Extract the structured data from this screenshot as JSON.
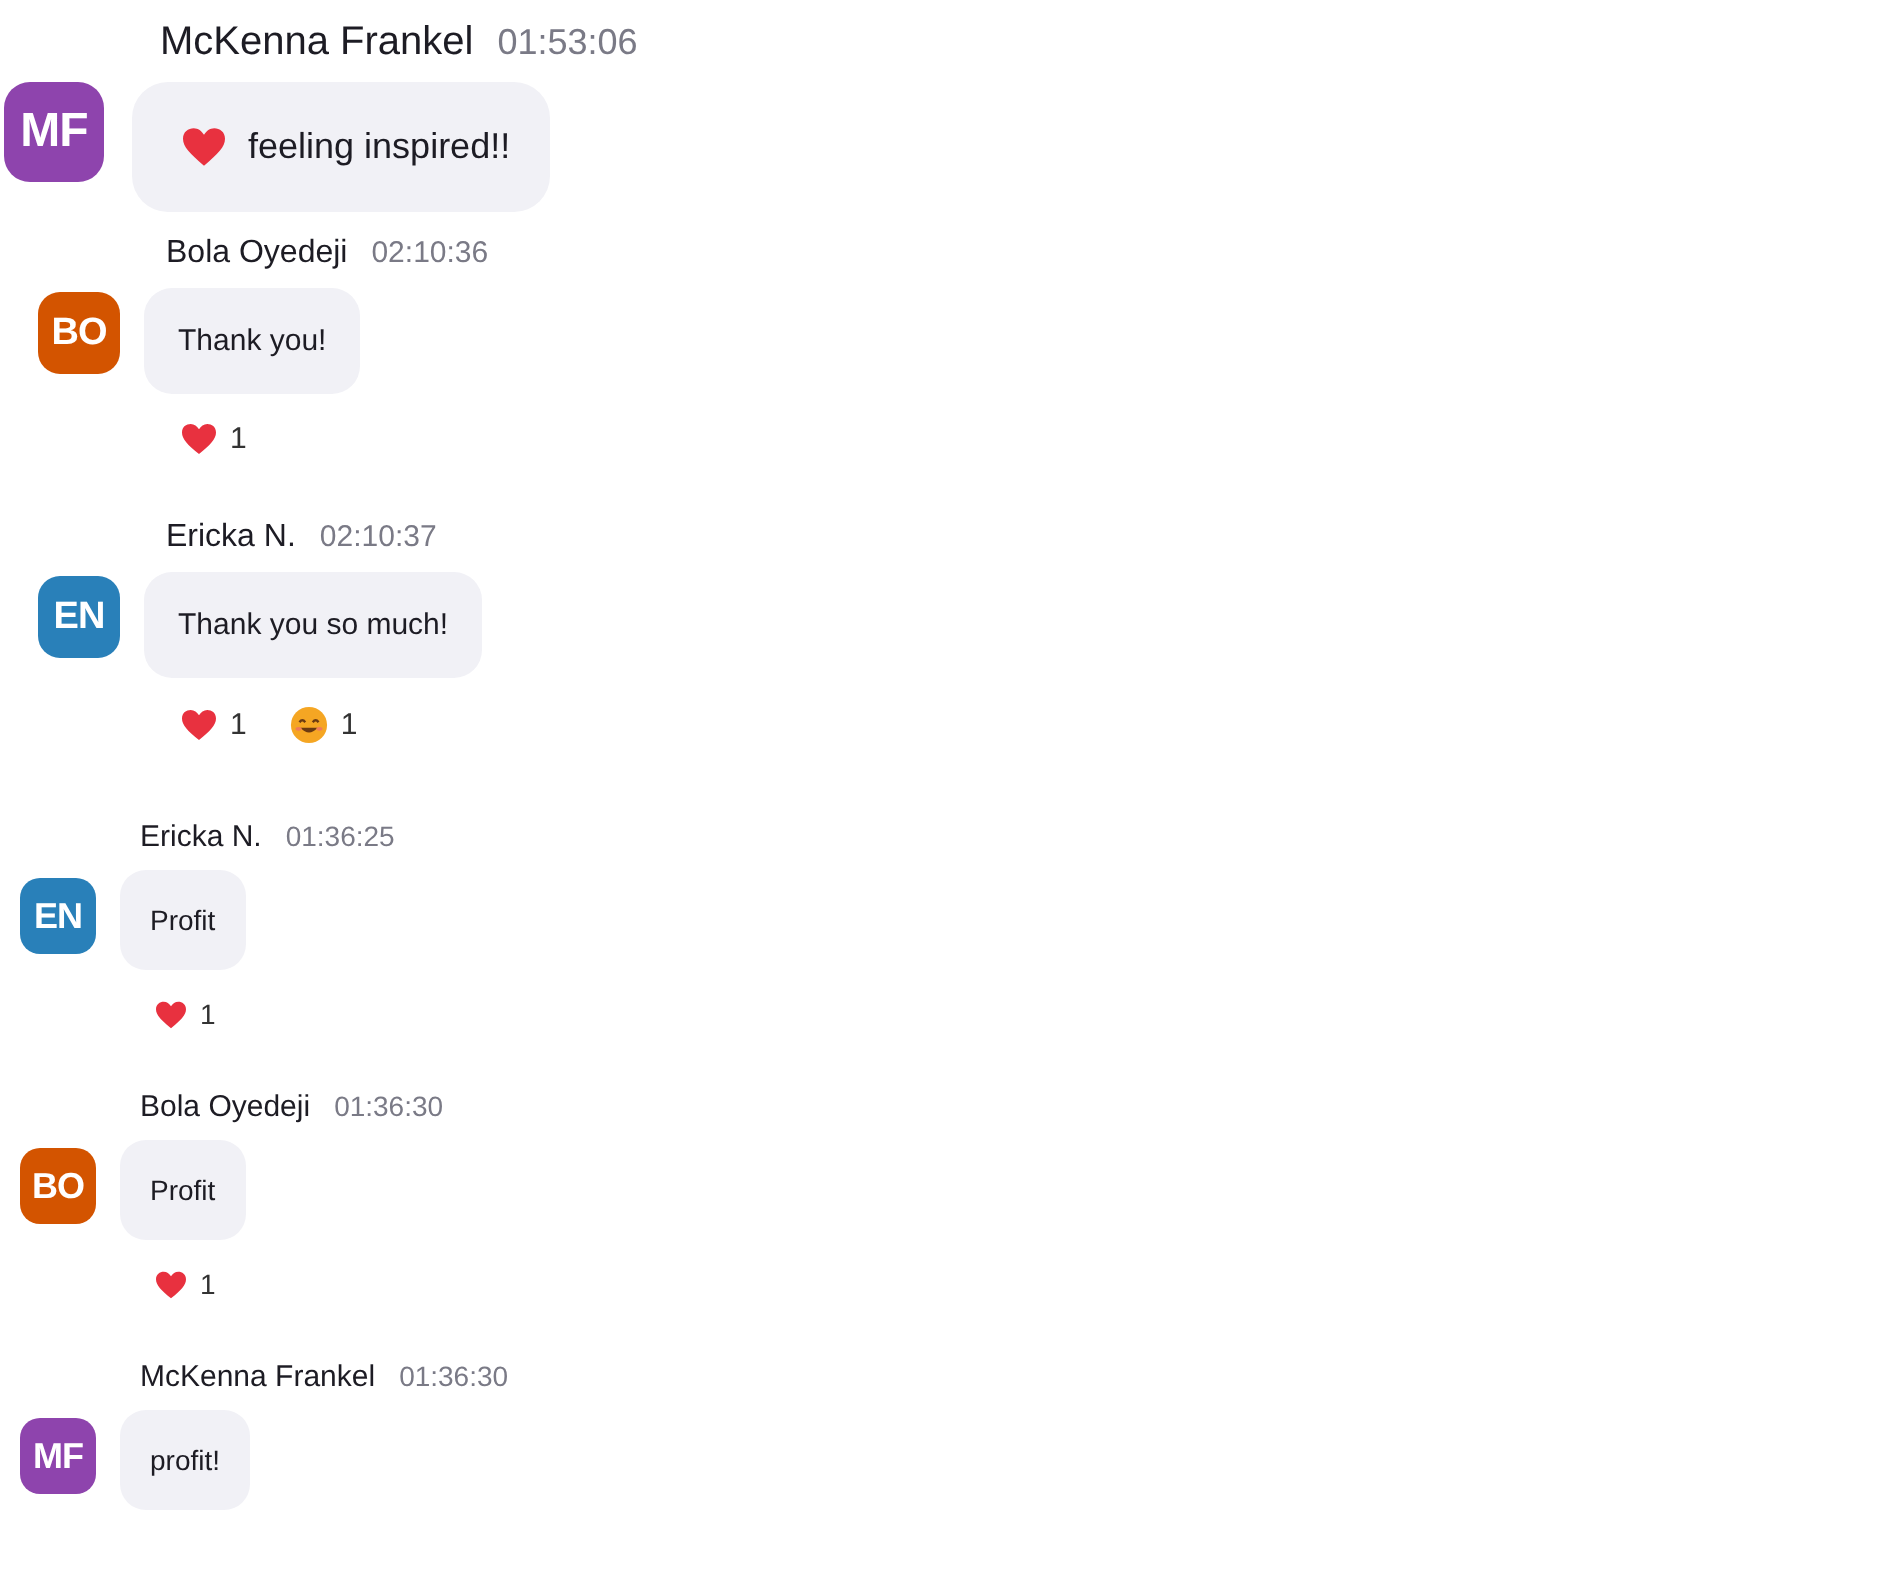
{
  "messages": [
    {
      "kind": "status",
      "author": "McKenna Frankel",
      "time": "01:53:06",
      "initials": "MF",
      "color": "#8e44ad",
      "text": "feeling inspired!!"
    },
    {
      "kind": "text",
      "author": "Bola Oyedeji",
      "time": "02:10:36",
      "initials": "BO",
      "color": "#d35400",
      "text": "Thank you!",
      "reactions": [
        {
          "kind": "heart",
          "count": "1"
        }
      ]
    },
    {
      "kind": "text",
      "author": "Ericka N.",
      "time": "02:10:37",
      "initials": "EN",
      "color": "#2980b9",
      "text": "Thank you so much!",
      "reactions": [
        {
          "kind": "heart",
          "count": "1"
        },
        {
          "kind": "smile",
          "count": "1"
        }
      ]
    },
    {
      "kind": "text",
      "author": "Ericka N.",
      "time": "01:36:25",
      "initials": "EN",
      "color": "#2980b9",
      "text": "Profit",
      "reactions": [
        {
          "kind": "heart",
          "count": "1"
        }
      ]
    },
    {
      "kind": "text",
      "author": "Bola Oyedeji",
      "time": "01:36:30",
      "initials": "BO",
      "color": "#d35400",
      "text": "Profit",
      "reactions": [
        {
          "kind": "heart",
          "count": "1"
        }
      ]
    },
    {
      "kind": "text",
      "author": "McKenna Frankel",
      "time": "01:36:30",
      "initials": "MF",
      "color": "#8e44ad",
      "text": "profit!"
    }
  ]
}
